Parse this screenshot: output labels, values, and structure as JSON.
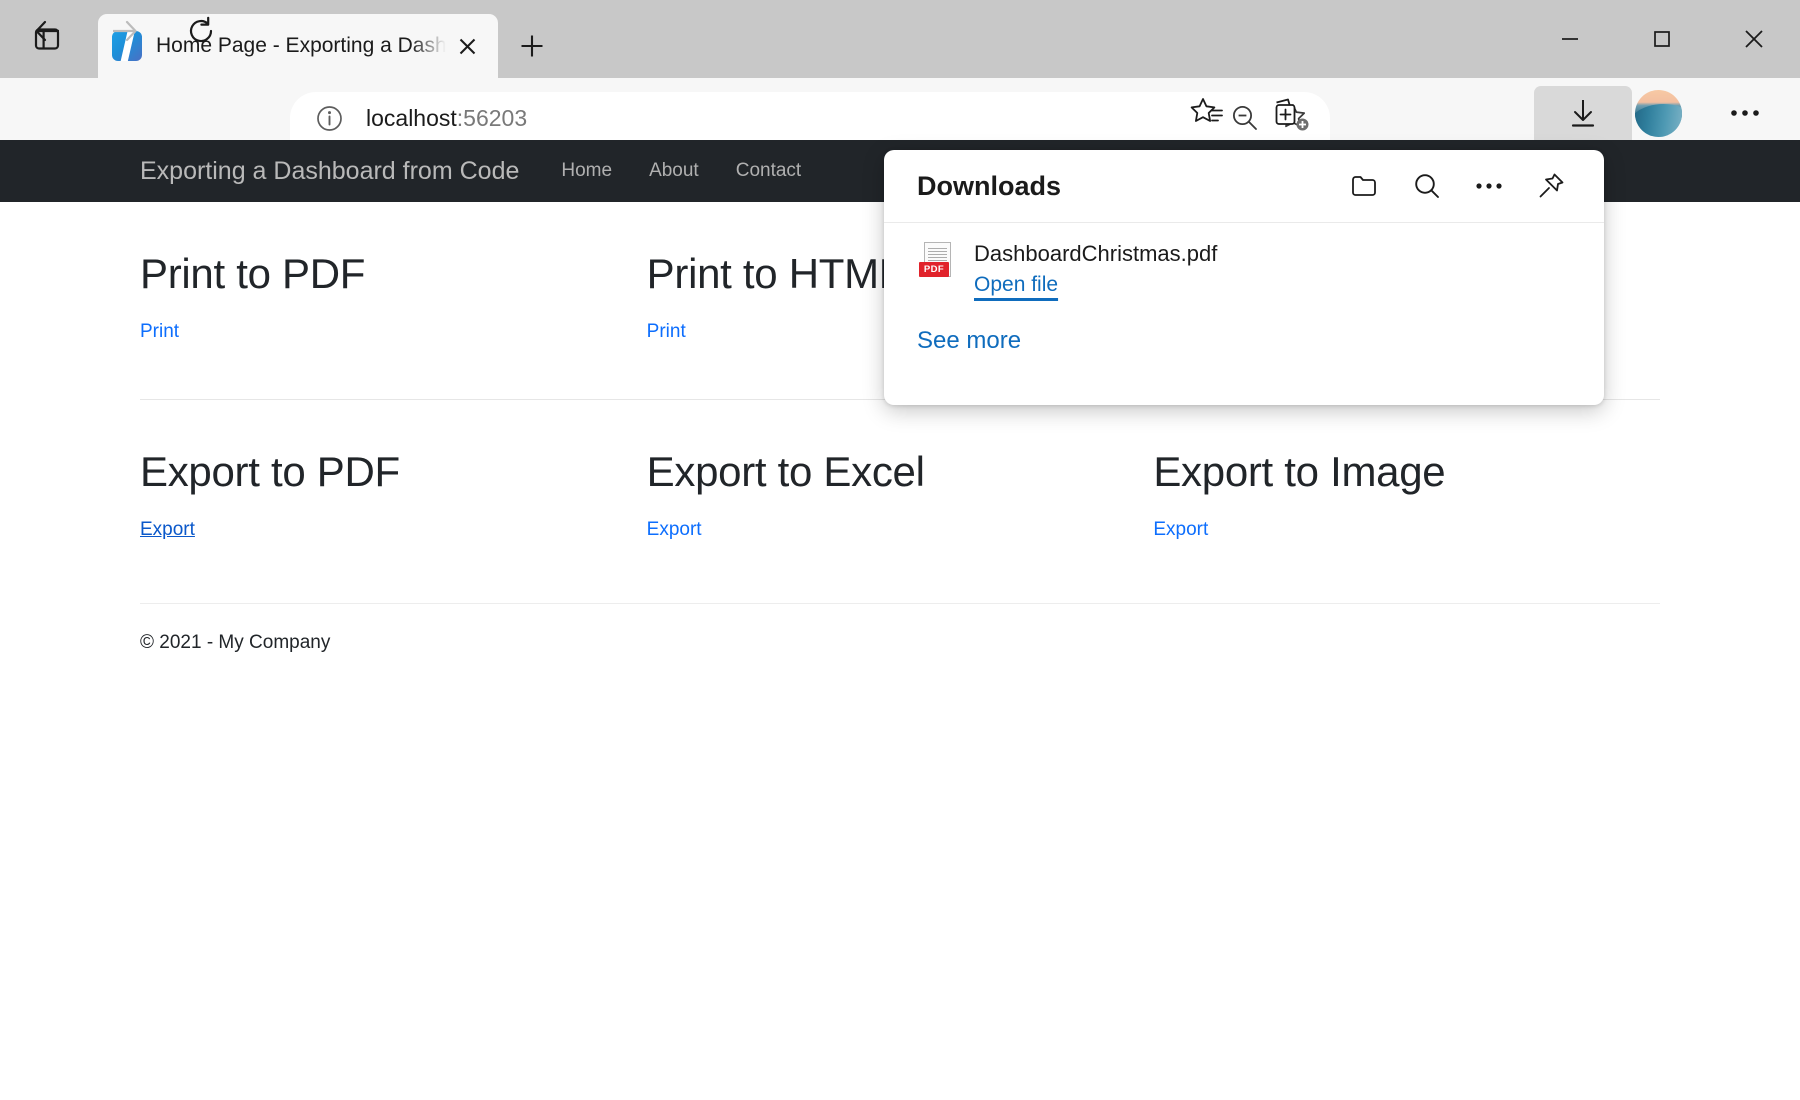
{
  "browser": {
    "tab": {
      "title": "Home Page - Exporting a Dashbo",
      "favicon_name": "app-favicon"
    },
    "new_tab_label": "+",
    "window_controls": {
      "minimize": "minimize",
      "maximize": "maximize",
      "close": "close"
    },
    "nav": {
      "back": "back",
      "forward": "forward",
      "refresh": "refresh"
    },
    "address": {
      "host": "localhost",
      "port": ":56203",
      "info_icon": "site-info-icon"
    },
    "toolbar_icons": [
      "zoom-out-icon",
      "add-favorite-icon",
      "favorites-icon",
      "collections-icon",
      "downloads-icon",
      "profile-avatar",
      "settings-more-icon"
    ]
  },
  "downloads": {
    "title": "Downloads",
    "actions": [
      "open-folder-icon",
      "search-icon",
      "more-options-icon",
      "pin-icon"
    ],
    "items": [
      {
        "filename": "DashboardChristmas.pdf",
        "action_label": "Open file",
        "filetype": "PDF"
      }
    ],
    "see_more": "See more"
  },
  "site": {
    "brand": "Exporting a Dashboard from Code",
    "nav_links": [
      "Home",
      "About",
      "Contact"
    ],
    "cards_row1": [
      {
        "title": "Print to PDF",
        "link": "Print"
      },
      {
        "title": "Print to HTML",
        "link": "Print"
      },
      {
        "title": "",
        "link": ""
      }
    ],
    "cards_row2": [
      {
        "title": "Export to PDF",
        "link": "Export"
      },
      {
        "title": "Export to Excel",
        "link": "Export"
      },
      {
        "title": "Export to Image",
        "link": "Export"
      }
    ],
    "footer": "© 2021 - My Company"
  },
  "colors": {
    "navbar_bg": "#212529",
    "link_blue": "#0d6efd",
    "flyout_link": "#0f6cbd",
    "pdf_red": "#e1232b",
    "chrome_bg": "#c8c8c8",
    "toolbar_bg": "#f7f7f7"
  }
}
